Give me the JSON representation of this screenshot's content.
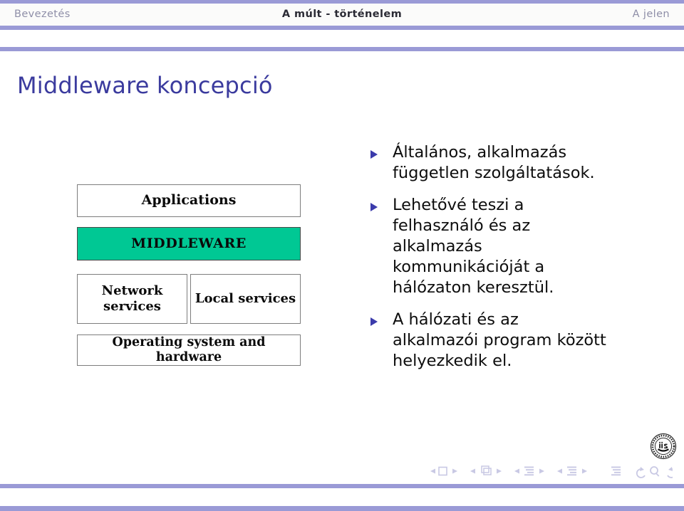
{
  "header": {
    "nav_left": "Bevezetés",
    "nav_center": "A múlt - történelem",
    "nav_right": "A jelen",
    "bar_color": "#9a9ad6"
  },
  "slide": {
    "title": "Middleware koncepció",
    "title_color": "#3b3b9e"
  },
  "diagram": {
    "name": "middleware-layer-stack",
    "boxes": [
      {
        "id": "applications",
        "label": "Applications",
        "fill": "#ffffff"
      },
      {
        "id": "middleware",
        "label": "MIDDLEWARE",
        "fill": "#00c894"
      },
      {
        "id": "network",
        "label": "Network services",
        "fill": "#ffffff"
      },
      {
        "id": "local",
        "label": "Local services",
        "fill": "#ffffff"
      },
      {
        "id": "os",
        "label": "Operating system and hardware",
        "fill": "#ffffff"
      }
    ]
  },
  "bullets": {
    "marker_color": "#3b3bab",
    "items": [
      "Általános, alkalmazás független szolgáltatások.",
      "Lehetővé teszi a felhasználó és az alkalmazás kommunikációját a hálózaton keresztül.",
      "A hálózati és az alkalmazói program között helyezkedik el."
    ]
  },
  "navigation_symbols": {
    "color": "#c9c9e4",
    "groups": [
      {
        "name": "frame-navigation",
        "back": "prev-frame",
        "icon": "frame-icon",
        "forward": "next-frame"
      },
      {
        "name": "subsection-navigation",
        "back": "prev-subsection",
        "icon": "subsection-icon",
        "forward": "next-subsection"
      },
      {
        "name": "section-navigation",
        "back": "prev-section",
        "icon": "section-icon",
        "forward": "next-section"
      },
      {
        "name": "presentation-navigation",
        "back": "prev-doc",
        "icon": "document-icon",
        "forward": "next-doc"
      }
    ],
    "extras": [
      "toc-icon",
      "back-icon",
      "search-icon",
      "forward-icon"
    ]
  },
  "logo": {
    "name": "university-seal",
    "initials": "iis"
  }
}
